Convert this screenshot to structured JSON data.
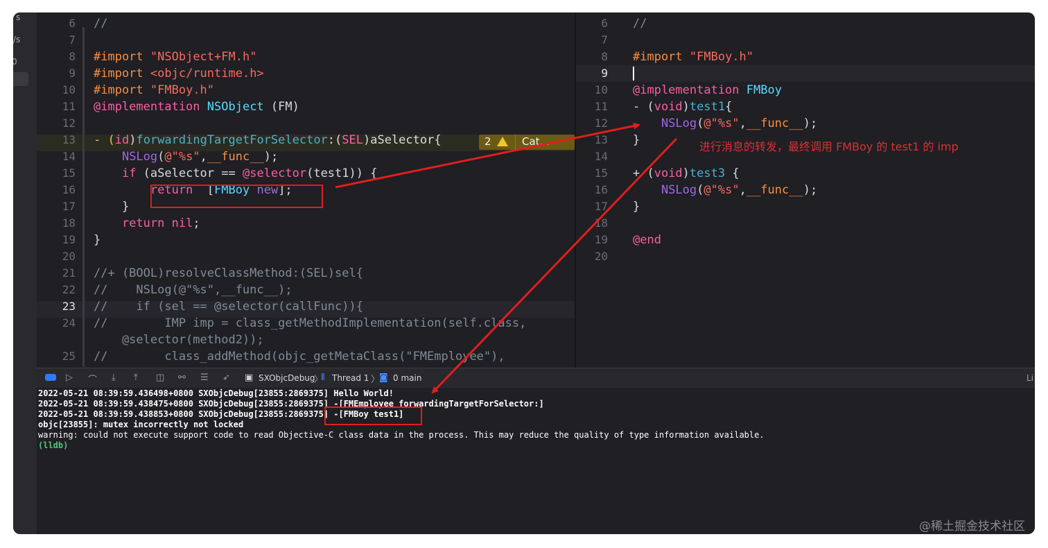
{
  "sidebar": {
    "frag1": "s",
    "frag2": "/s",
    "frag3": "0"
  },
  "left_pane": {
    "line_numbers": [
      "6",
      "7",
      "8",
      "9",
      "10",
      "11",
      "12",
      "13",
      "14",
      "15",
      "16",
      "17",
      "18",
      "19",
      "20",
      "21",
      "22",
      "23",
      "24",
      "",
      "25"
    ],
    "current_line": "23",
    "lines": {
      "l6": "//",
      "l8_kw": "#import",
      "l8_str": "\"NSObject+FM.h\"",
      "l9_kw": "#import",
      "l9_str": "<objc/runtime.h>",
      "l10_kw": "#import",
      "l10_str": "\"FMBoy.h\"",
      "l11_kw": "@implementation",
      "l11_cls": "NSObject",
      "l11_rest": " (FM)",
      "l13_a": "- (",
      "l13_id": "id",
      "l13_b": ")",
      "l13_sel": "forwardingTargetForSelector",
      "l13_c": ":(",
      "l13_SEL": "SEL",
      "l13_d": ")aSelector{",
      "l14_fn": "NSLog",
      "l14_a": "(",
      "l14_str": "@\"%s\"",
      "l14_b": ",",
      "l14_mac": "__func__",
      "l14_c": ");",
      "l15_if": "if",
      "l15_a": " (aSelector == ",
      "l15_at": "@selector",
      "l15_b": "(test1)) {",
      "l16_ret": "return",
      "l16_a": "  [",
      "l16_cls": "FMBoy",
      "l16_sp": " ",
      "l16_new": "new",
      "l16_b": "];",
      "l17": "}",
      "l18_ret": "return",
      "l18_nil": "nil",
      "l18_b": ";",
      "l19": "}",
      "l21": "//+ (BOOL)resolveClassMethod:(SEL)sel{",
      "l22": "//    NSLog(@\"%s\",__func__);",
      "l23": "//    if (sel == @selector(callFunc)){",
      "l24": "//        IMP imp = class_getMethodImplementation(self.class,",
      "l24b": "    @selector(method2));",
      "l25": "//        class_addMethod(objc_getMetaClass(\"FMEmployee\"),"
    },
    "warning": {
      "count": "2",
      "label": "Cat..."
    }
  },
  "right_pane": {
    "line_numbers": [
      "6",
      "7",
      "8",
      "9",
      "10",
      "11",
      "12",
      "13",
      "14",
      "15",
      "16",
      "17",
      "18",
      "19",
      "20"
    ],
    "current_line": "9",
    "lines": {
      "l6": "//",
      "l8_kw": "#import",
      "l8_str": "\"FMBoy.h\"",
      "l10_kw": "@implementation",
      "l10_cls": "FMBoy",
      "l11_a": "- (",
      "l11_void": "void",
      "l11_b": ")",
      "l11_name": "test1",
      "l11_c": "{",
      "l12_fn": "NSLog",
      "l12_a": "(",
      "l12_str": "@\"%s\"",
      "l12_b": ",",
      "l12_mac": "__func__",
      "l12_c": ");",
      "l13": "}",
      "l15_a": "+ (",
      "l15_void": "void",
      "l15_b": ")",
      "l15_name": "test3",
      "l15_c": " {",
      "l16_fn": "NSLog",
      "l16_a": "(",
      "l16_str": "@\"%s\"",
      "l16_b": ",",
      "l16_mac": "__func__",
      "l16_c": ");",
      "l17": "}",
      "l19": "@end"
    }
  },
  "annotation": "进行消息的转发，最终调用 FMBoy 的 test1 的 imp",
  "debug_bar": {
    "target": "SXObjcDebug",
    "thread": "Thread 1",
    "frame": "0 main",
    "right_fragment": "Li"
  },
  "console": {
    "lines": [
      "2022-05-21 08:39:59.436498+0800 SXObjcDebug[23855:2869375] Hello World!",
      "2022-05-21 08:39:59.438475+0800 SXObjcDebug[23855:2869375] -[FMEmployee forwardingTargetForSelector:]",
      "2022-05-21 08:39:59.438853+0800 SXObjcDebug[23855:2869375] -[FMBoy test1]",
      "objc[23855]: mutex incorrectly not locked",
      "warning: could not execute support code to read Objective-C class data in the process. This may reduce the quality of type information available."
    ],
    "prompt": "(lldb)"
  },
  "watermark": "@稀土掘金技术社区",
  "colors": {
    "keyword": "#fc5fa3",
    "string": "#fc6a5d",
    "preprocessor": "#fd8f3f",
    "type": "#5dd8ff",
    "function": "#a167e6",
    "comment": "#7f8c98",
    "annotation_red": "#e01e1e"
  }
}
